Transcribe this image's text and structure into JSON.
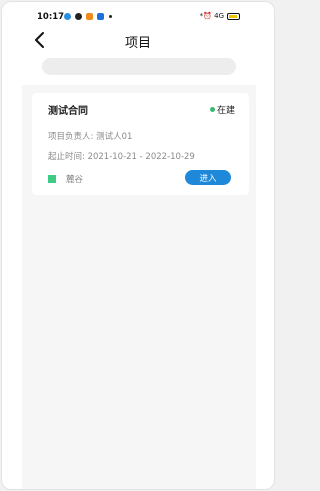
{
  "status_bar": {
    "time": "10:17",
    "right_text": "*⏰ 4G"
  },
  "header": {
    "title": "项目"
  },
  "project_card": {
    "name": "测试合同",
    "status": "在建",
    "owner": "项目负责人: 测试人01",
    "period": "起止时间: 2021-10-21 - 2022-10-29",
    "tag": "麓谷",
    "enter_label": "进入"
  },
  "colors": {
    "accent": "#1e88d9",
    "status_green": "#3bb873",
    "tag_green": "#3ecb85"
  }
}
